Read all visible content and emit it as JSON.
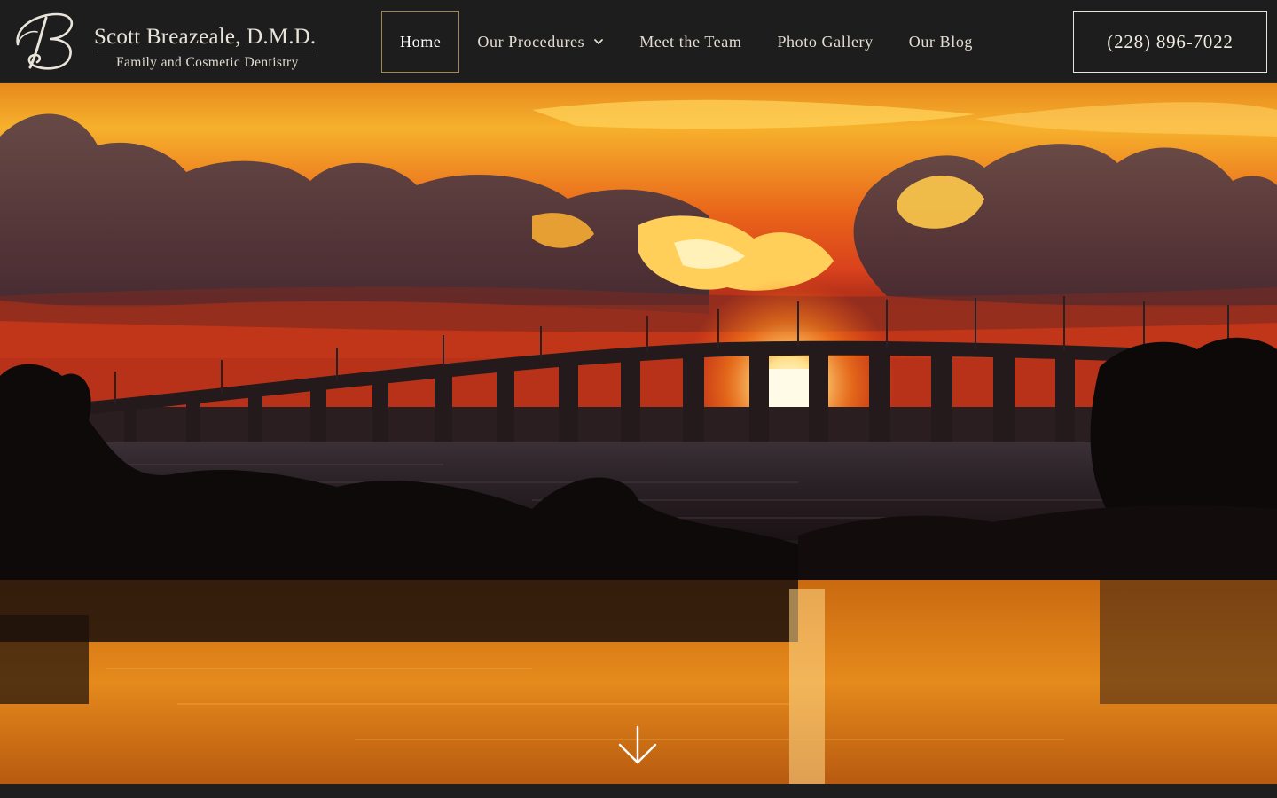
{
  "brand": {
    "monogram": "B",
    "name": "Scott Breazeale, D.M.D.",
    "tagline": "Family and Cosmetic Dentistry"
  },
  "nav": {
    "items": [
      {
        "label": "Home",
        "active": true
      },
      {
        "label": "Our Procedures",
        "has_dropdown": true
      },
      {
        "label": "Meet the Team"
      },
      {
        "label": "Photo Gallery"
      },
      {
        "label": "Our Blog"
      }
    ]
  },
  "phone": "(228) 896-7022",
  "hero": {
    "image": "sunset-over-bridge-and-bay",
    "scroll_icon": "arrow-down-icon"
  },
  "colors": {
    "header_bg": "#1d1d1d",
    "active_border": "#a08a52",
    "sky_orange": "#f08a1a",
    "sun": "#fff4d6"
  }
}
